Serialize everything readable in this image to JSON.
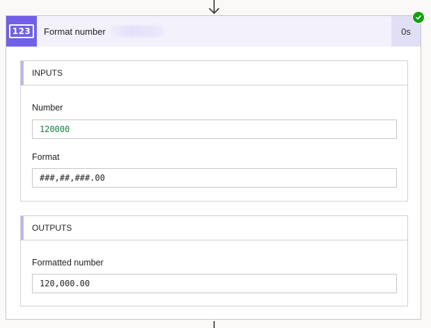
{
  "action": {
    "title": "Format number",
    "duration": "0s",
    "icon_text": "123",
    "status": "succeeded",
    "accent_color": "#7160e8",
    "success_color": "#13a10e"
  },
  "inputs": {
    "heading": "INPUTS",
    "number_label": "Number",
    "number_value": "120000",
    "format_label": "Format",
    "format_value": "###,##,###.00"
  },
  "outputs": {
    "heading": "OUTPUTS",
    "formatted_label": "Formatted number",
    "formatted_value": "120,000.00"
  }
}
